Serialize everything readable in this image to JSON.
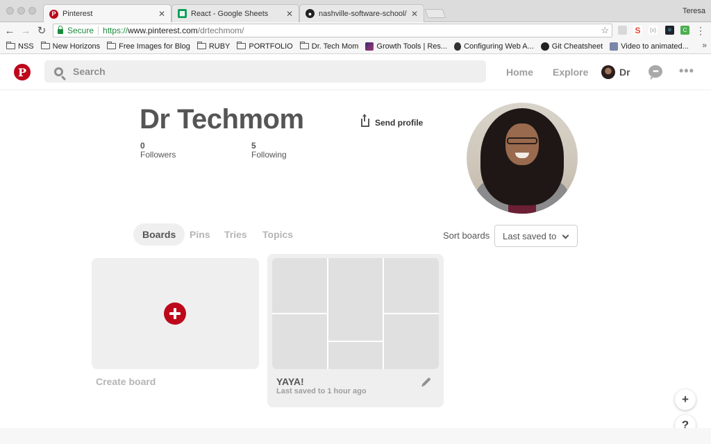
{
  "browser": {
    "user_name": "Teresa",
    "tabs": [
      {
        "title": "Pinterest",
        "active": true,
        "favicon": "pinterest-icon"
      },
      {
        "title": "React - Google Sheets",
        "active": false,
        "favicon": "sheets-icon"
      },
      {
        "title": "nashville-software-school/gro",
        "active": false,
        "favicon": "github-icon"
      }
    ],
    "omnibox": {
      "secure_label": "Secure",
      "url_scheme": "https://",
      "url_host": "www.pinterest.com",
      "url_path": "/drtechmom/"
    },
    "bookmarks": [
      {
        "label": "NSS",
        "icon": "folder-icon"
      },
      {
        "label": "New Horizons",
        "icon": "folder-icon"
      },
      {
        "label": "Free Images for Blog",
        "icon": "folder-icon"
      },
      {
        "label": "RUBY",
        "icon": "folder-icon"
      },
      {
        "label": "PORTFOLIO",
        "icon": "folder-icon"
      },
      {
        "label": "Dr. Tech Mom",
        "icon": "folder-icon"
      },
      {
        "label": "Growth Tools | Res...",
        "icon": "growth-tools-icon"
      },
      {
        "label": "Configuring Web A...",
        "icon": "apple-icon"
      },
      {
        "label": "Git Cheatsheet",
        "icon": "github-icon"
      },
      {
        "label": "Video to animated...",
        "icon": "video-icon"
      }
    ],
    "bookmarks_overflow": "»"
  },
  "header": {
    "logo_glyph": "P",
    "search_placeholder": "Search",
    "nav": {
      "home": "Home",
      "explore": "Explore"
    },
    "user_short": "Dr",
    "chat_glyph": "•••",
    "more_glyph": "•••"
  },
  "profile": {
    "name": "Dr Techmom",
    "followers_count": "0",
    "followers_label": "Followers",
    "following_count": "5",
    "following_label": "Following",
    "send_profile_label": "Send profile"
  },
  "tabs": {
    "items": [
      "Boards",
      "Pins",
      "Tries",
      "Topics"
    ],
    "active": "Boards"
  },
  "sort": {
    "label": "Sort boards",
    "selected": "Last saved to"
  },
  "boards": {
    "create_label": "Create board",
    "items": [
      {
        "title": "YAYA!",
        "meta": "Last saved to 1 hour ago"
      }
    ]
  },
  "fabs": {
    "add": "+",
    "help": "?"
  },
  "colors": {
    "brand_red": "#bd081c",
    "secure_green": "#1b8a3c",
    "tile_gray": "#efefef"
  }
}
